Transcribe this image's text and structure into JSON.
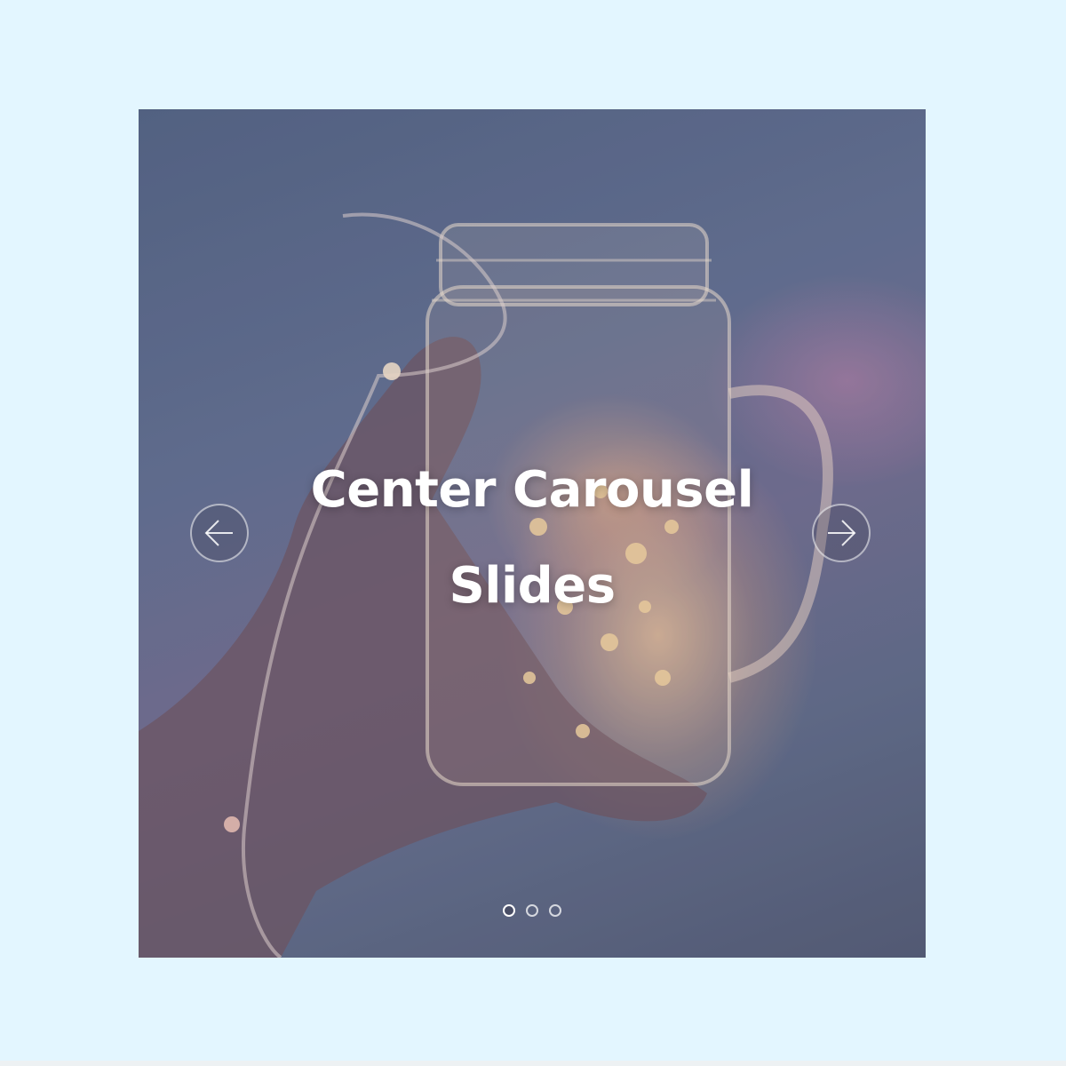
{
  "carousel": {
    "title_line1": "Center Carousel",
    "title_line2": "Slides",
    "prev_icon": "arrow-left-icon",
    "next_icon": "arrow-right-icon",
    "slide_count": 3,
    "active_index": 0
  },
  "colors": {
    "page_background": "#e3f6ff",
    "title_text": "#ffffff"
  }
}
